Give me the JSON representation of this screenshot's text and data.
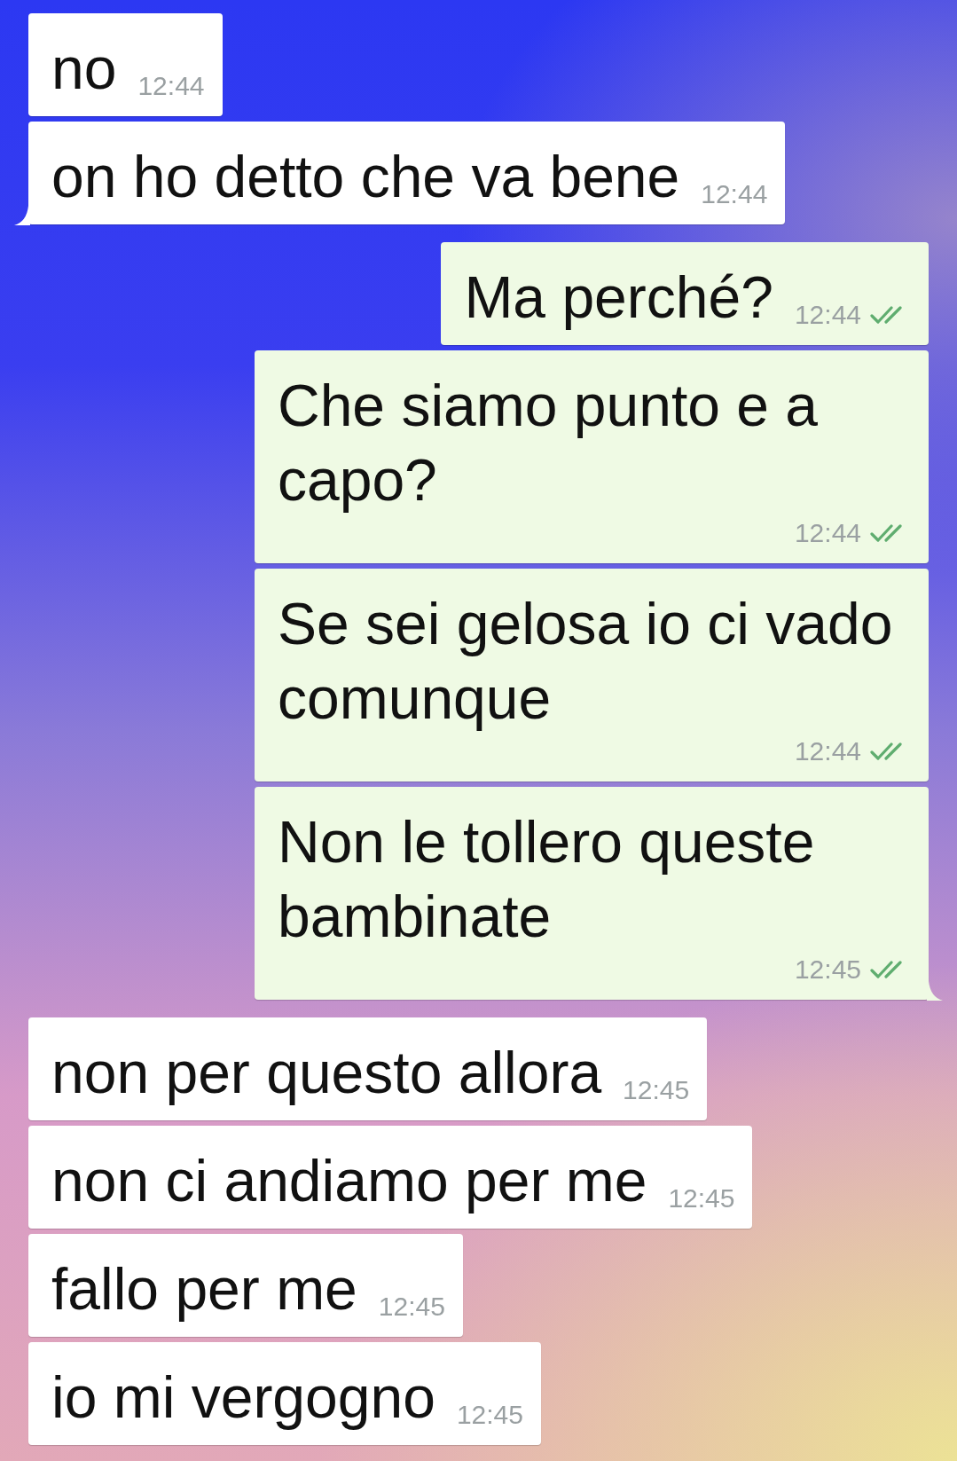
{
  "messages": [
    {
      "kind": "incoming",
      "text": "no",
      "time": "12:44",
      "tail": false
    },
    {
      "kind": "incoming",
      "text": "on ho detto che va bene",
      "time": "12:44",
      "tail": true
    },
    {
      "kind": "outgoing",
      "text": "Ma perché?",
      "time": "12:44",
      "delivered": true,
      "tail": false
    },
    {
      "kind": "outgoing",
      "text": "Che siamo punto e a capo?",
      "time": "12:44",
      "delivered": true,
      "tail": false
    },
    {
      "kind": "outgoing",
      "text": "Se sei gelosa io ci vado comunque",
      "time": "12:44",
      "delivered": true,
      "tail": false
    },
    {
      "kind": "outgoing",
      "text": "Non le tollero queste bambinate",
      "time": "12:45",
      "delivered": true,
      "tail": true
    },
    {
      "kind": "incoming",
      "text": "non per questo allora",
      "time": "12:45",
      "tail": false
    },
    {
      "kind": "incoming",
      "text": "non ci andiamo per me",
      "time": "12:45",
      "tail": false
    },
    {
      "kind": "incoming",
      "text": "fallo per me",
      "time": "12:45",
      "tail": false
    },
    {
      "kind": "incoming",
      "text": "io mi vergogno",
      "time": "12:45",
      "tail": false
    }
  ]
}
